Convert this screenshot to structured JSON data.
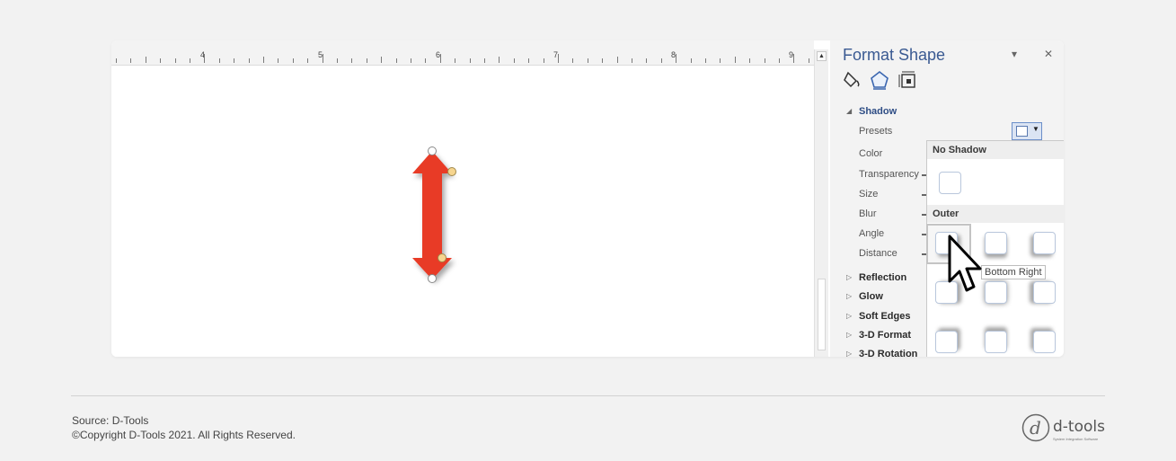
{
  "ruler": {
    "marks": [
      "4",
      "5",
      "6",
      "7",
      "8",
      "9"
    ]
  },
  "scrollbar": {
    "up_glyph": "▲"
  },
  "pane": {
    "title": "Format Shape",
    "dropdown_glyph": "▾",
    "close_glyph": "✕",
    "icons": [
      "fill-line-icon",
      "effects-icon",
      "size-properties-icon"
    ],
    "section_title": "Shadow",
    "rows": [
      "Presets",
      "Color",
      "Transparency",
      "Size",
      "Blur",
      "Angle",
      "Distance"
    ],
    "collapsed_sections": [
      "Reflection",
      "Glow",
      "Soft Edges",
      "3-D Format",
      "3-D Rotation"
    ],
    "expanded_glyph": "◢",
    "collapsed_glyph": "▷",
    "presets_dropdown_glyph": "▼"
  },
  "gallery": {
    "no_shadow_header": "No Shadow",
    "outer_header": "Outer",
    "tooltip": "Bottom Right"
  },
  "shape": {
    "fill_color": "#e83a26",
    "handle_color": "#f6d58f"
  },
  "footer": {
    "source": "Source: D-Tools",
    "copyright": "©Copyright D-Tools 2021. All Rights Reserved.",
    "logo_word": "d-tools",
    "logo_tagline": "System Integration Software"
  }
}
